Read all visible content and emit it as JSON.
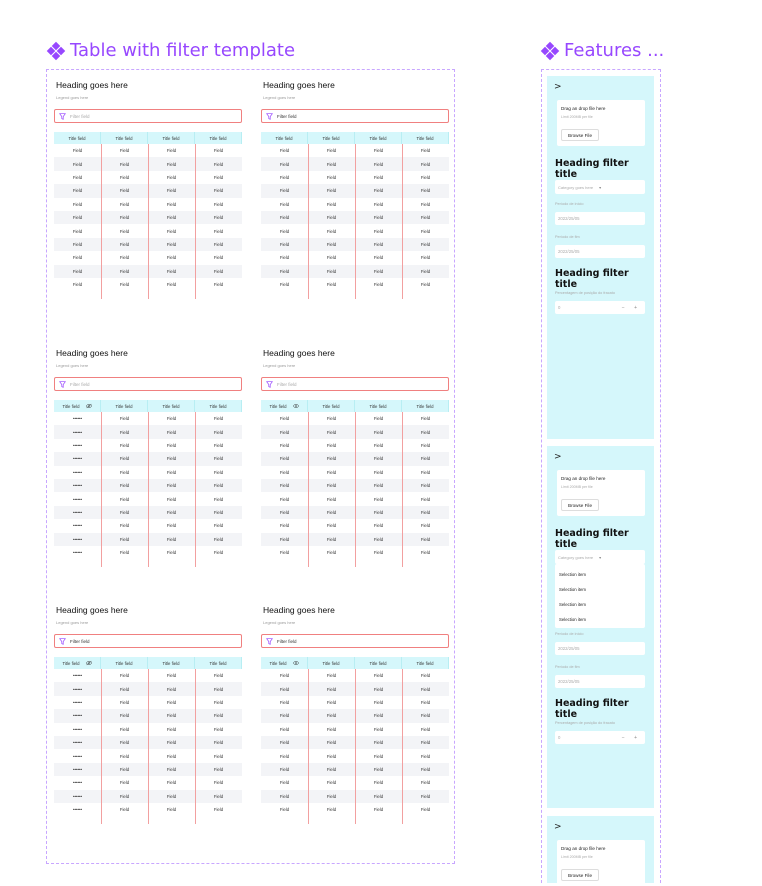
{
  "left_frame": {
    "title": "Table with filter template",
    "cards": [
      {
        "heading": "Heading goes here",
        "legend": "Legend goes here",
        "filter_text": "Filter field",
        "filter_filled": false,
        "first_col_icon": "",
        "masked": false
      },
      {
        "heading": "Heading goes here",
        "legend": "Legend goes here",
        "filter_text": "Filter field",
        "filter_filled": true,
        "first_col_icon": "",
        "masked": false
      },
      {
        "heading": "Heading goes here",
        "legend": "Legend goes here",
        "filter_text": "Filter field",
        "filter_filled": false,
        "first_col_icon": "eye-off-icon",
        "masked": true
      },
      {
        "heading": "Heading goes here",
        "legend": "Legend goes here",
        "filter_text": "Filter field",
        "filter_filled": false,
        "first_col_icon": "eye-icon",
        "masked": false
      },
      {
        "heading": "Heading goes here",
        "legend": "Legend goes here",
        "filter_text": "Filter field",
        "filter_filled": true,
        "first_col_icon": "eye-off-icon",
        "masked": true
      },
      {
        "heading": "Heading goes here",
        "legend": "Legend goes here",
        "filter_text": "Filter field",
        "filter_filled": true,
        "first_col_icon": "eye-icon",
        "masked": false
      }
    ],
    "table": {
      "headers": [
        "Title field",
        "Title field",
        "Title field",
        "Title field"
      ],
      "cell": "Field",
      "masked_cell": "••••••",
      "row_count": 11
    }
  },
  "right_frame": {
    "title": "Features ...",
    "panels": [
      {
        "chevron": ">",
        "upload_title": "Drag an drop file here",
        "upload_limit": "Limit 200MB per file",
        "browse_label": "Browse File",
        "section_title_1": "Heading filter title",
        "category_placeholder": "Category goes here",
        "dropdown_items": [],
        "start_label": "Período de início",
        "start_value": "2022/25/05",
        "end_label": "Período de fim",
        "end_value": "2022/25/05",
        "section_title_2": "Heading filter title",
        "percent_label": "Percentagem de posição do fracato",
        "percent_value": "0",
        "stepper_controls": "− +"
      },
      {
        "chevron": ">",
        "upload_title": "Drag an drop file here",
        "upload_limit": "Limit 200MB per file",
        "browse_label": "Browse File",
        "section_title_1": "Heading filter title",
        "category_placeholder": "Category goes here",
        "dropdown_items": [
          "Selection item",
          "Selection item",
          "Selection item",
          "Selection item"
        ],
        "start_label": "Período de início",
        "start_value": "2022/25/05",
        "end_label": "Período de fim",
        "end_value": "2022/25/05",
        "section_title_2": "Heading filter title",
        "percent_label": "Percentagem de posição do fracato",
        "percent_value": "0",
        "stepper_controls": "− +"
      },
      {
        "chevron": ">",
        "upload_title": "Drag an drop file here",
        "upload_limit": "Limit 200MB per file",
        "browse_label": "Browse File"
      }
    ]
  },
  "colors": {
    "accent_purple": "#9747ff",
    "header_cyan": "#d5f7fb",
    "filter_border": "#f08080",
    "stripe": "#f3f4f7"
  }
}
